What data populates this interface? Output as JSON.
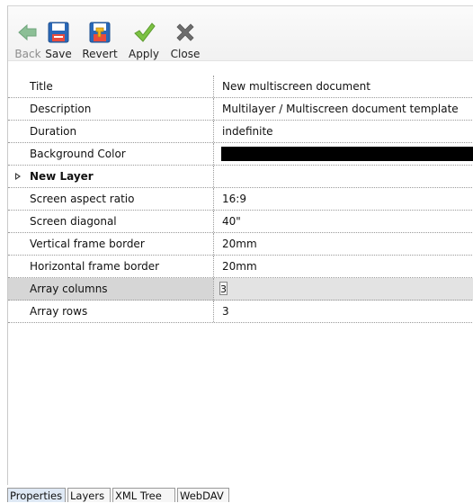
{
  "toolbar": {
    "back": {
      "label": "Back",
      "icon": "back-arrow-icon",
      "enabled": false
    },
    "save": {
      "label": "Save",
      "icon": "floppy-disk-icon"
    },
    "revert": {
      "label": "Revert",
      "icon": "revert-disk-icon"
    },
    "apply": {
      "label": "Apply",
      "icon": "checkmark-icon"
    },
    "close": {
      "label": "Close",
      "icon": "close-x-icon"
    }
  },
  "properties": {
    "title": {
      "label": "Title",
      "value": "New multiscreen document"
    },
    "description": {
      "label": "Description",
      "value": "Multilayer / Multiscreen document template"
    },
    "duration": {
      "label": "Duration",
      "value": "indefinite"
    },
    "background_color": {
      "label": "Background Color",
      "color": "#000000"
    },
    "group": {
      "label": "New Layer",
      "expanded": false
    },
    "screen_aspect_ratio": {
      "label": "Screen aspect ratio",
      "value": "16:9"
    },
    "screen_diagonal": {
      "label": "Screen diagonal",
      "value": "40\""
    },
    "vertical_frame_border": {
      "label": "Vertical frame border",
      "value": "20mm"
    },
    "horizontal_frame_border": {
      "label": "Horizontal frame border",
      "value": "20mm"
    },
    "array_columns": {
      "label": "Array columns",
      "value": "3",
      "selected": true
    },
    "array_rows": {
      "label": "Array rows",
      "value": "3"
    }
  },
  "tabs": [
    {
      "label": "Properties",
      "active": true
    },
    {
      "label": "Layers"
    },
    {
      "label": "XML Tree"
    },
    {
      "label": "WebDAV"
    }
  ],
  "colors": {
    "apply_green": "#7cc243",
    "close_gray": "#6e6e6e",
    "back_green": "#8cbf96",
    "save_blue": "#2a68b8",
    "selection_gray": "#d6d6d6"
  }
}
